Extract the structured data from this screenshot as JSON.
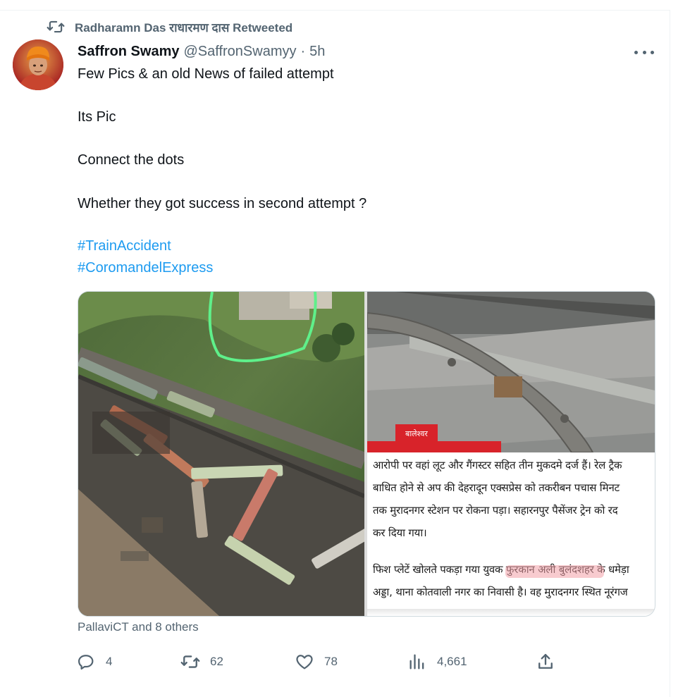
{
  "retweet_notice": {
    "text": "Radharamn Das राधारमण दास Retweeted",
    "icon": "retweet-icon"
  },
  "tweet": {
    "author": {
      "display_name": "Saffron Swamy",
      "handle": "@SaffronSwamyy",
      "separator": "·",
      "time": "5h"
    },
    "text_lines": [
      "Few Pics & an old News of failed attempt",
      "Its Pic",
      "Connect the dots",
      "Whether they got success in second attempt ?"
    ],
    "hashtags": [
      "#TrainAccident",
      "#CoromandelExpress"
    ],
    "news_clip": {
      "lines": [
        "आरोपी पर वहां लूट और गैंगस्टर सहित तीन मुकदमे दर्ज हैं। रेल ट्रैक",
        "बाधित होने से अप की देहरादून एक्सप्रेस को तकरीबन पचास मिनट",
        "तक मुरादनगर स्टेशन पर रोकना पड़ा। सहारनपुर पैसेंजर ट्रेन को रद",
        "कर दिया गया।",
        "फिश प्लेटें खोलते पकड़ा गया युवक फुरकान अली बुलंदशहर के धमेड़ा",
        "अड्डा, थाना कोतवाली नगर का निवासी है। वह मुरादनगर स्थित नूरंगज"
      ],
      "highlight": "फुरकान अली बुलंदशहर",
      "tv_tag": "बालेश्वर"
    },
    "liked_by": "PallaviCT and 8 others",
    "stats": {
      "replies": "4",
      "retweets": "62",
      "likes": "78",
      "views": "4,661"
    },
    "colors": {
      "link": "#1d9bf0",
      "secondary_text": "#536471",
      "primary_text": "#0f1419"
    }
  }
}
